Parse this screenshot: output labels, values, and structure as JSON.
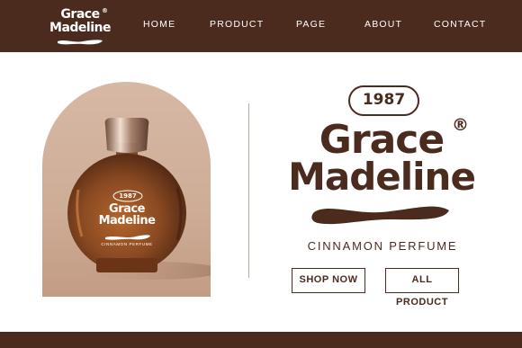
{
  "header": {
    "logo": {
      "line1": "Grace",
      "line2": "Madeline",
      "registered": "®"
    },
    "nav": [
      {
        "label": "HOME"
      },
      {
        "label": "PRODUCT"
      },
      {
        "label": "PAGE"
      },
      {
        "label": "ABOUT"
      },
      {
        "label": "CONTACT"
      }
    ]
  },
  "product_image": {
    "label_year": "1987",
    "label_line1": "Grace",
    "label_line2": "Madeline",
    "label_registered": "®",
    "label_subtitle": "CINNAMON PERFUME"
  },
  "hero": {
    "year": "1987",
    "brand_line1": "Grace",
    "brand_line2": "Madeline",
    "registered": "®",
    "tagline": "CINNAMON PERFUME",
    "buttons": {
      "shop_now": "SHOP NOW",
      "all_product": "ALL PRODUCT"
    }
  },
  "colors": {
    "brand_brown": "#4a2b1e",
    "background": "#ffffff",
    "bottle_amber": "#8a4a22"
  },
  "icons": [
    "logo-swoosh-icon",
    "registered-mark-icon",
    "brand-swoosh-icon"
  ]
}
